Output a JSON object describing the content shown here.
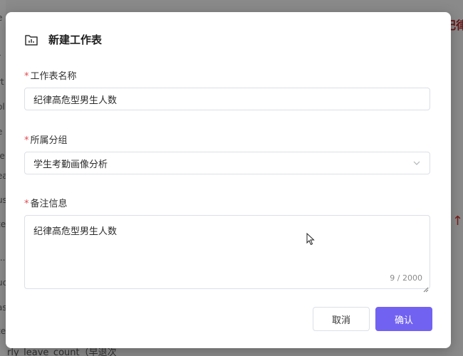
{
  "dialog": {
    "title": "新建工作表",
    "icon": "folder-chart-icon"
  },
  "fields": {
    "name": {
      "label": "工作表名称",
      "required_mark": "*",
      "value": "纪律高危型男生人数"
    },
    "group": {
      "label": "所属分组",
      "required_mark": "*",
      "value": "学生考勤画像分析"
    },
    "notes": {
      "label": "备注信息",
      "required_mark": "*",
      "value": "纪律高危型男生人数",
      "char_count": "9 / 2000"
    }
  },
  "buttons": {
    "cancel": "取消",
    "confirm": "确认"
  },
  "background": {
    "right_text": "纪律",
    "bottom_text": "rly_leave_count（早退次",
    "left_fragments": [
      "e",
      "r",
      "rt",
      "ol",
      "e",
      "le",
      "ea",
      "us",
      "te",
      "...",
      "uc",
      "ast",
      "te"
    ]
  },
  "colors": {
    "primary": "#7262f2",
    "required": "#e5484d",
    "border": "#dcdfe6"
  }
}
